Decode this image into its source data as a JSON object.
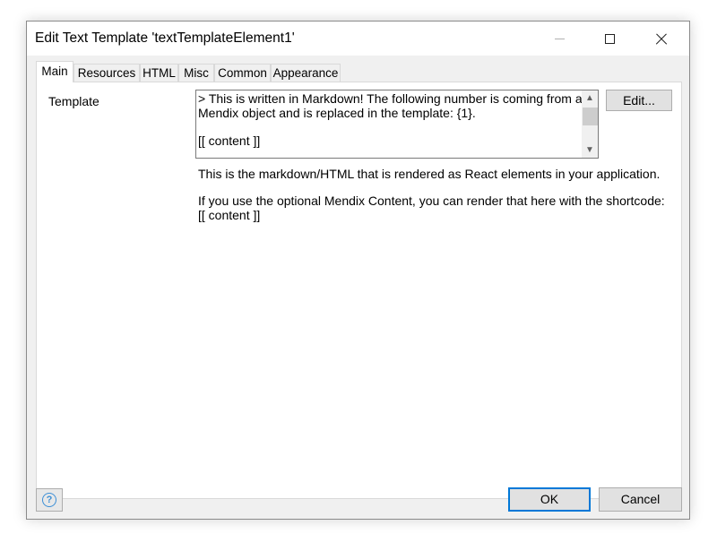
{
  "window": {
    "title": "Edit Text Template 'textTemplateElement1'"
  },
  "titlebar_buttons": {
    "minimize": "minimize-icon",
    "maximize": "maximize-icon",
    "close": "close-icon"
  },
  "tabs": [
    {
      "label": "Main",
      "active": true
    },
    {
      "label": "Resources",
      "active": false
    },
    {
      "label": "HTML",
      "active": false
    },
    {
      "label": "Misc",
      "active": false
    },
    {
      "label": "Common",
      "active": false
    },
    {
      "label": "Appearance",
      "active": false
    }
  ],
  "main": {
    "template_label": "Template",
    "template_value_lines": [
      "> This is written in Markdown! The following number is coming from a",
      "Mendix object and is replaced in the template: {1}.",
      "",
      "[[ content ]]"
    ],
    "edit_button": "Edit...",
    "description_1": "This is the markdown/HTML that is rendered as React elements in your application.",
    "description_2_line1": "If you use the optional Mendix Content, you can render that here with the shortcode:",
    "description_2_line2": "[[ content ]]"
  },
  "footer": {
    "help_icon": "help-icon",
    "help_glyph": "?",
    "ok": "OK",
    "cancel": "Cancel"
  },
  "colors": {
    "focus_border": "#0078d7",
    "help_icon": "#3c8fd6",
    "dialog_bg": "#f0f0f0"
  }
}
